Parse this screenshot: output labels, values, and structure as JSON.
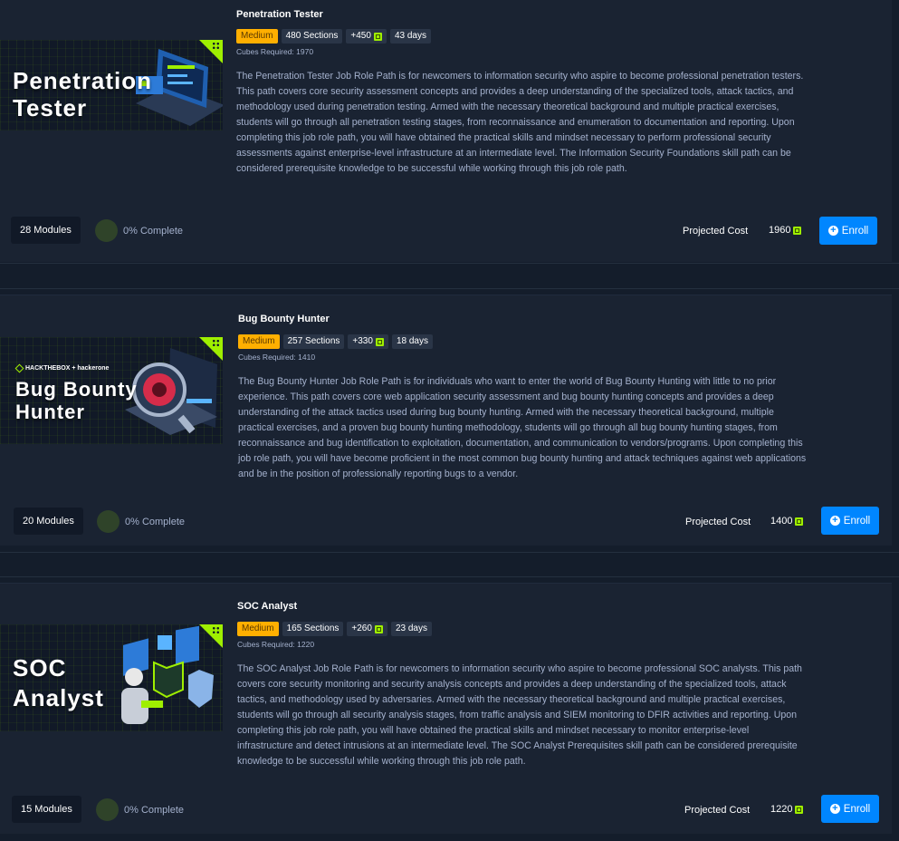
{
  "paths": [
    {
      "thumb_title": "Penetration\nTester",
      "title": "Penetration Tester",
      "difficulty": "Medium",
      "sections": "480 Sections",
      "reward": "+450",
      "duration": "43 days",
      "cubes_required": "Cubes Required: 1970",
      "description": "The Penetration Tester Job Role Path is for newcomers to information security who aspire to become professional penetration testers. This path covers core security assessment concepts and provides a deep understanding of the specialized tools, attack tactics, and methodology used during penetration testing. Armed with the necessary theoretical background and multiple practical exercises, students will go through all penetration testing stages, from reconnaissance and enumeration to documentation and reporting. Upon completing this job role path, you will have obtained the practical skills and mindset necessary to perform professional security assessments against enterprise-level infrastructure at an intermediate level. The Information Security Foundations skill path can be considered prerequisite knowledge to be successful while working through this job role path.",
      "modules": "28 Modules",
      "progress": "0% Complete",
      "progress_fraction": 0,
      "cost_label": "Projected Cost",
      "cost": "1960",
      "enroll_label": "Enroll"
    },
    {
      "thumb_title": "Bug Bounty\nHunter",
      "thumb_brand": "HACKTHEBOX + hackerone",
      "title": "Bug Bounty Hunter",
      "difficulty": "Medium",
      "sections": "257 Sections",
      "reward": "+330",
      "duration": "18 days",
      "cubes_required": "Cubes Required: 1410",
      "description": "The Bug Bounty Hunter Job Role Path is for individuals who want to enter the world of Bug Bounty Hunting with little to no prior experience. This path covers core web application security assessment and bug bounty hunting concepts and provides a deep understanding of the attack tactics used during bug bounty hunting. Armed with the necessary theoretical background, multiple practical exercises, and a proven bug bounty hunting methodology, students will go through all bug bounty hunting stages, from reconnaissance and bug identification to exploitation, documentation, and communication to vendors/programs. Upon completing this job role path, you will have become proficient in the most common bug bounty hunting and attack techniques against web applications and be in the position of professionally reporting bugs to a vendor.",
      "modules": "20 Modules",
      "progress": "0% Complete",
      "progress_fraction": 0,
      "cost_label": "Projected Cost",
      "cost": "1400",
      "enroll_label": "Enroll"
    },
    {
      "thumb_title": "SOC\nAnalyst",
      "title": "SOC Analyst",
      "difficulty": "Medium",
      "sections": "165 Sections",
      "reward": "+260",
      "duration": "23 days",
      "cubes_required": "Cubes Required: 1220",
      "description": "The SOC Analyst Job Role Path is for newcomers to information security who aspire to become professional SOC analysts. This path covers core security monitoring and security analysis concepts and provides a deep understanding of the specialized tools, attack tactics, and methodology used by adversaries. Armed with the necessary theoretical background and multiple practical exercises, students will go through all security analysis stages, from traffic analysis and SIEM monitoring to DFIR activities and reporting. Upon completing this job role path, you will have obtained the practical skills and mindset necessary to monitor enterprise-level infrastructure and detect intrusions at an intermediate level. The SOC Analyst Prerequisites skill path can be considered prerequisite knowledge to be successful while working through this job role path.",
      "modules": "15 Modules",
      "progress": "0% Complete",
      "progress_fraction": 0,
      "cost_label": "Projected Cost",
      "cost": "1220",
      "enroll_label": "Enroll"
    }
  ],
  "colors": {
    "background": "#141d2b",
    "card": "#1a2332",
    "accent_green": "#9fef00",
    "difficulty_medium": "#ffaf00",
    "enroll_blue": "#0086ff"
  }
}
